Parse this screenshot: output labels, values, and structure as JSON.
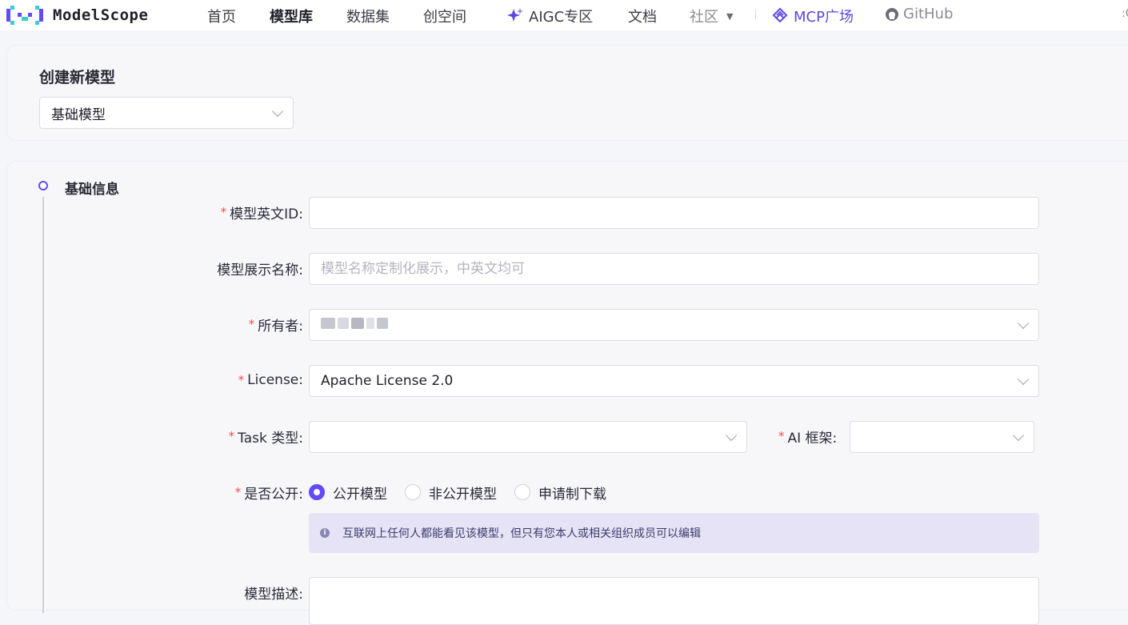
{
  "nav": {
    "logo_text": "ModelScope",
    "items": [
      {
        "label": "首页"
      },
      {
        "label": "模型库"
      },
      {
        "label": "数据集"
      },
      {
        "label": "创空间"
      },
      {
        "label": "AIGC专区"
      },
      {
        "label": "文档"
      },
      {
        "label": "社区"
      },
      {
        "label": "MCP广场"
      },
      {
        "label": "GitHub"
      }
    ],
    "active_item": "模型库",
    "cut_text": ":C"
  },
  "create": {
    "title": "创建新模型",
    "type_value": "基础模型"
  },
  "basic": {
    "title": "基础信息",
    "model_id": {
      "label": "模型英文ID:",
      "required": true,
      "value": ""
    },
    "display_name": {
      "label": "模型展示名称:",
      "required": false,
      "placeholder": "模型名称定制化展示，中英文均可"
    },
    "owner": {
      "label": "所有者:",
      "required": true
    },
    "license": {
      "label": "License:",
      "required": true,
      "value": "Apache License 2.0"
    },
    "task_type": {
      "label": "Task 类型:",
      "required": true,
      "value": ""
    },
    "ai_framework": {
      "label": "AI 框架:",
      "required": true,
      "value": ""
    },
    "visibility": {
      "label": "是否公开:",
      "required": true,
      "options": [
        "公开模型",
        "非公开模型",
        "申请制下载"
      ],
      "selected": "公开模型"
    },
    "info_text": "互联网上任何人都能看见该模型，但只有您本人或相关组织成员可以编辑",
    "description": {
      "label": "模型描述:"
    }
  },
  "colors": {
    "accent": "#624aff",
    "required": "#f0504a",
    "info_bg": "#e6e3f6"
  }
}
